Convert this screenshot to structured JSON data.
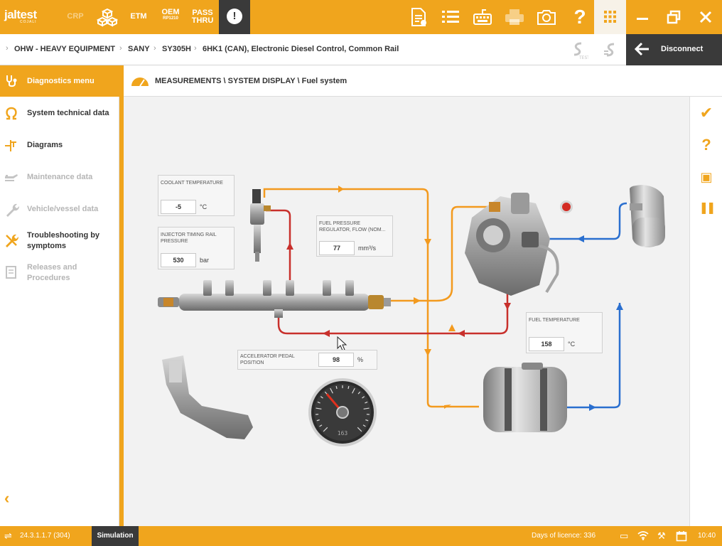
{
  "topbar": {
    "logo": "jaltest",
    "logo_sub": "COJALI",
    "nav": [
      {
        "label": "CRP",
        "sub": "",
        "enabled": false
      },
      {
        "label": "ETM",
        "sub": "",
        "enabled": true
      },
      {
        "label": "OEM",
        "sub": "RP1210",
        "enabled": true
      },
      {
        "label": "PASS",
        "sub": "THRU",
        "enabled": true
      }
    ],
    "alert_glyph": "!",
    "icons": [
      "report-icon",
      "list-icon",
      "keyboard-icon",
      "printer-icon",
      "camera-icon",
      "help-icon",
      "apps-grid-icon"
    ],
    "help_glyph": "?",
    "window_controls": [
      "minimize-icon",
      "restore-icon",
      "close-icon"
    ],
    "colors": {
      "accent": "#f0a51d",
      "dark": "#3a3a3a"
    }
  },
  "breadcrumb": {
    "items": [
      "OHW - HEAVY EQUIPMENT",
      "SANY",
      "SY305H",
      "6HK1 (CAN), Electronic Diesel Control, Common Rail"
    ],
    "disconnect_label": "Disconnect"
  },
  "sidebar": {
    "items": [
      {
        "label": "Diagnostics menu",
        "icon": "stethoscope-icon",
        "state": "active"
      },
      {
        "label": "System technical data",
        "icon": "ohm-icon",
        "state": "enabled"
      },
      {
        "label": "Diagrams",
        "icon": "diagram-icon",
        "state": "enabled"
      },
      {
        "label": "Maintenance data",
        "icon": "oil-can-icon",
        "state": "disabled"
      },
      {
        "label": "Vehicle/vessel data",
        "icon": "wrench-icon",
        "state": "disabled"
      },
      {
        "label": "Troubleshooting by symptoms",
        "icon": "tools-icon",
        "state": "enabled"
      },
      {
        "label": "Releases and Procedures",
        "icon": "document-icon",
        "state": "disabled"
      }
    ],
    "collapse_glyph": "‹"
  },
  "title": {
    "path": "MEASUREMENTS \\ SYSTEM DISPLAY \\ Fuel system"
  },
  "right_tools": [
    {
      "name": "confirm-icon",
      "glyph": "✔"
    },
    {
      "name": "help-icon",
      "glyph": "?"
    },
    {
      "name": "clipboard-icon",
      "glyph": "▣"
    },
    {
      "name": "pause-icon",
      "glyph": "❚❚"
    }
  ],
  "measurements": {
    "coolant": {
      "label": "COOLANT TEMPERATURE",
      "value": "-5",
      "unit": "°C"
    },
    "injector": {
      "label": "INJECTOR TIMING RAIL PRESSURE",
      "value": "530",
      "unit": "bar"
    },
    "regulator": {
      "label": "FUEL PRESSURE REGULATOR, FLOW (NOM...",
      "value": "77",
      "unit": "mm³/s"
    },
    "fuel_temp": {
      "label": "FUEL TEMPERATURE",
      "value": "158",
      "unit": "°C"
    },
    "pedal": {
      "label": "ACCELERATOR PEDAL POSITION",
      "value": "98",
      "unit": "%"
    }
  },
  "gauge": {
    "reading": 0.35,
    "readout": "163"
  },
  "line_colors": {
    "low_pressure": "#f39a1e",
    "high_pressure": "#c8302c",
    "return": "#2a6fcf"
  },
  "statusbar": {
    "version": "24.3.1.1.7 (304)",
    "mode": "Simulation",
    "licence": "Days of licence: 336",
    "time": "10:40"
  }
}
